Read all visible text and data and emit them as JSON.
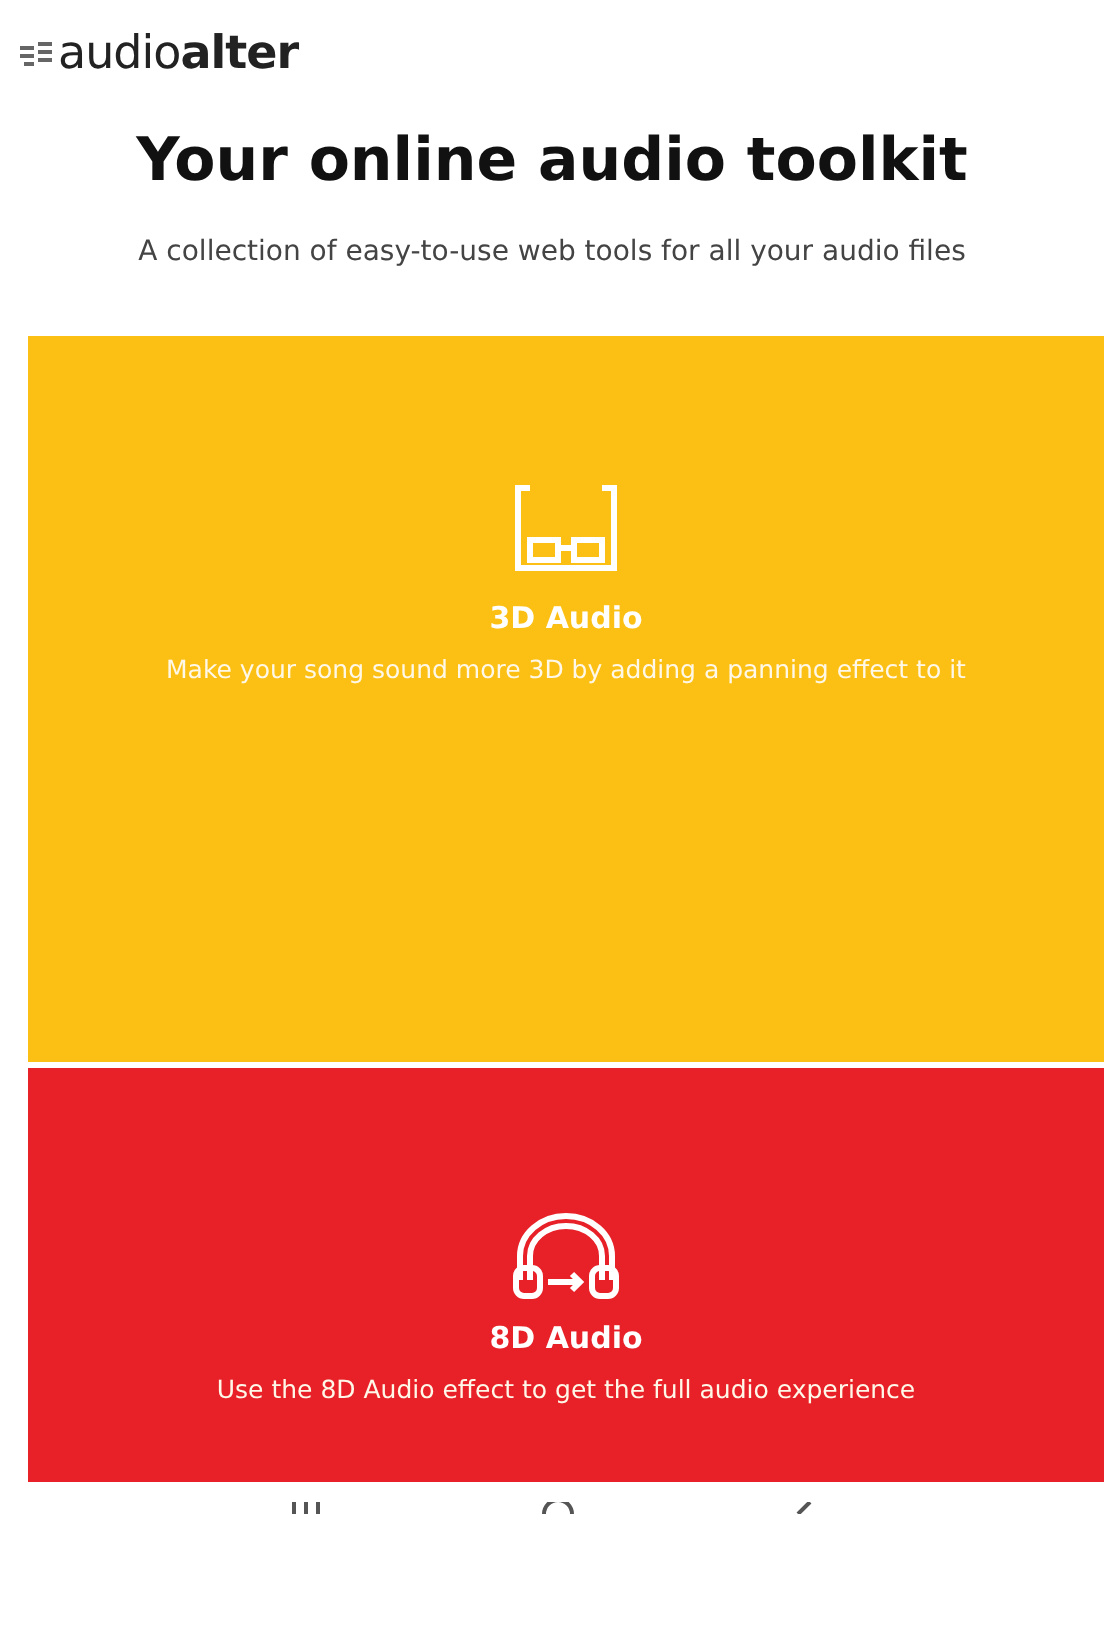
{
  "logo": {
    "light": "audio",
    "bold": "alter"
  },
  "title": "Your online audio toolkit",
  "subtitle": "A collection of easy-to-use web tools for all your audio files",
  "tools": [
    {
      "kind": "glasses",
      "title": "3D Audio",
      "description": "Make your song sound more 3D by adding a panning effect to it",
      "color": "#fcc015"
    },
    {
      "kind": "headphones",
      "title": "8D Audio",
      "description": "Use the 8D Audio effect to get the full audio experience",
      "color": "#e82129"
    }
  ]
}
